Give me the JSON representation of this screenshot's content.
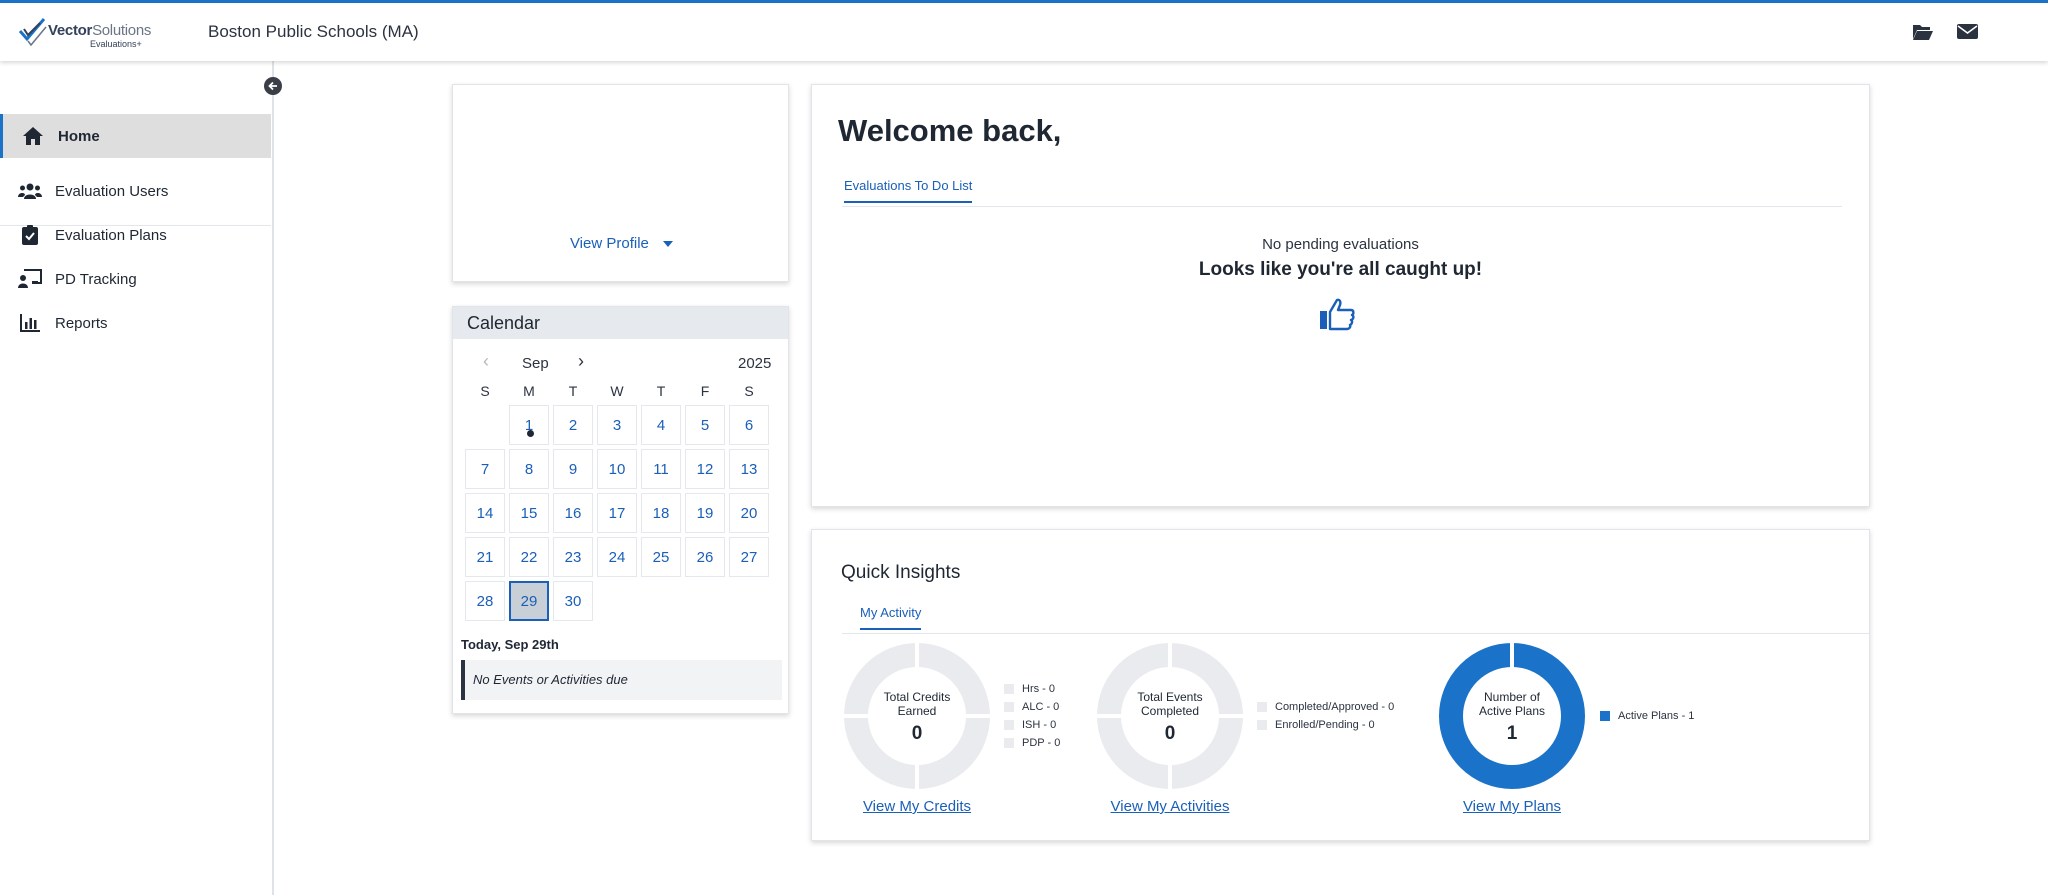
{
  "header": {
    "logo_brand": "Vector",
    "logo_brand2": "Solutions",
    "logo_sub": "Evaluations+",
    "org_name": "Boston Public Schools (MA)",
    "icons": [
      "folder-open-icon",
      "envelope-icon"
    ]
  },
  "sidebar": {
    "items": [
      {
        "label": "Home",
        "icon": "home-icon",
        "active": true
      },
      {
        "label": "Evaluation Users",
        "icon": "users-icon",
        "active": false
      },
      {
        "label": "Evaluation Plans",
        "icon": "clipboard-check-icon",
        "active": false
      },
      {
        "label": "PD Tracking",
        "icon": "chalkboard-user-icon",
        "active": false
      },
      {
        "label": "Reports",
        "icon": "bar-chart-icon",
        "active": false
      }
    ]
  },
  "profile": {
    "view_profile_label": "View Profile"
  },
  "calendar": {
    "title": "Calendar",
    "prev": "‹",
    "month": "Sep",
    "next": "›",
    "year": "2025",
    "weekdays": [
      "S",
      "M",
      "T",
      "W",
      "T",
      "F",
      "S"
    ],
    "first_weekday": 1,
    "days_in_month": 30,
    "today": 29,
    "event_days": [
      1
    ],
    "today_label": "Today, Sep 29th",
    "no_events_text": "No Events or Activities due"
  },
  "welcome": {
    "title": "Welcome back,",
    "tab_label": "Evaluations To Do List",
    "pending_text": "No pending evaluations",
    "caught_up_text": "Looks like you're all caught up!"
  },
  "insights": {
    "title": "Quick Insights",
    "tab_label": "My Activity",
    "widgets": [
      {
        "label_line1": "Total Credits",
        "label_line2": "Earned",
        "value": "0",
        "legend": [
          "Hrs - 0",
          "ALC - 0",
          "ISH - 0",
          "PDP - 0"
        ],
        "link": "View My Credits",
        "fill": 0
      },
      {
        "label_line1": "Total Events",
        "label_line2": "Completed",
        "value": "0",
        "legend": [
          "Completed/Approved - 0",
          "Enrolled/Pending - 0"
        ],
        "link": "View My Activities",
        "fill": 0
      },
      {
        "label_line1": "Number of",
        "label_line2": "Active Plans",
        "value": "1",
        "legend": [
          "Active Plans - 1"
        ],
        "link": "View My Plans",
        "fill": 1
      }
    ]
  },
  "colors": {
    "accent": "#1a73c8",
    "link": "#1a5fb8",
    "donut_empty": "#e9ebee",
    "text_dark": "#1f2733"
  }
}
